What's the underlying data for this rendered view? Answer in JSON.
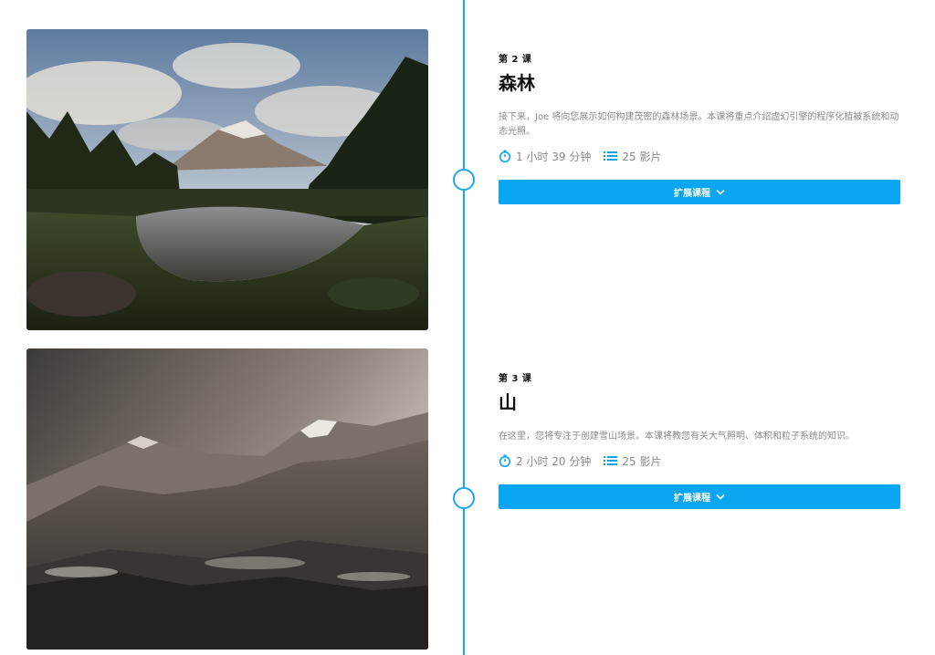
{
  "lessons": [
    {
      "number": "第 2 课",
      "title": "森林",
      "description": "接下来，Joe 将向您展示如何构建茂密的森林场景。本课将重点介绍虚幻引擎的程序化植被系统和动态光照。",
      "duration": "1 小时 39 分钟",
      "videos": "25 影片",
      "expand_label": "扩展课程",
      "image_icon": "forest-lake-landscape"
    },
    {
      "number": "第 3 课",
      "title": "山",
      "description": "在这里，您将专注于创建雪山场景。本课将教您有关大气照明、体积和粒子系统的知识。",
      "duration": "2 小时 20 分钟",
      "videos": "25 影片",
      "expand_label": "扩展课程",
      "image_icon": "snowy-mountain-landscape"
    }
  ],
  "colors": {
    "accent": "#0aa6f2",
    "timeline": "#1aa8f0",
    "muted_text": "#8a8a8a"
  }
}
